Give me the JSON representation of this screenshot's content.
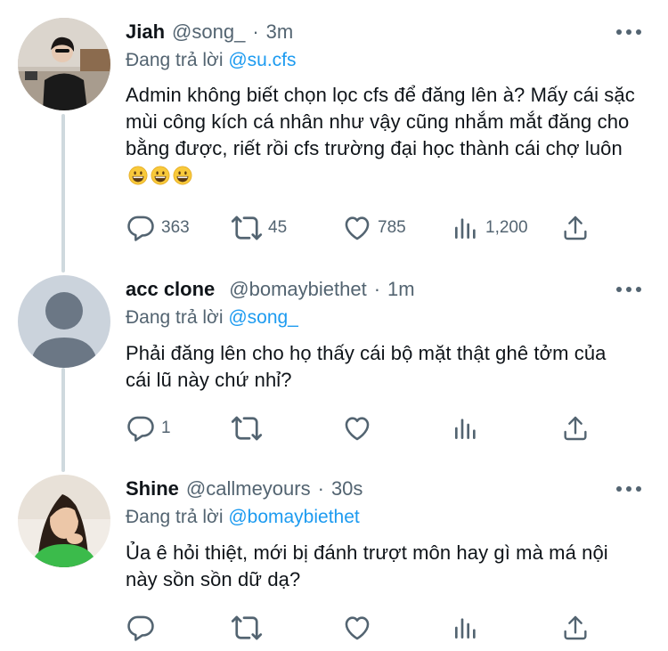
{
  "tweets": [
    {
      "name": "Jiah",
      "handle": "@song_",
      "dot": "·",
      "time": "3m",
      "replying_prefix": "Đang trả lời",
      "replying_to": "@su.cfs",
      "text": "Admin không biết chọn lọc cfs để đăng lên à? Mấy cái sặc mùi công kích cá nhân như vậy cũng nhắm mắt đăng cho bằng được, riết rồi cfs trường đại học thành cái chợ luôn",
      "emojis": [
        "grinning-face-emoji",
        "grinning-face-emoji",
        "grinning-face-emoji"
      ],
      "replies": "363",
      "retweets": "45",
      "likes": "785",
      "views": "1,200"
    },
    {
      "name": "acc clone",
      "handle": "@bomaybiethet",
      "dot": "·",
      "time": "1m",
      "replying_prefix": "Đang trả lời",
      "replying_to": "@song_",
      "text": "Phải đăng lên cho họ thấy cái bộ mặt thật ghê tởm của cái lũ này chứ nhỉ?",
      "replies": "1",
      "retweets": "",
      "likes": "",
      "views": ""
    },
    {
      "name": "Shine",
      "handle": "@callmeyours",
      "dot": "·",
      "time": "30s",
      "replying_prefix": "Đang trả lời",
      "replying_to": "@bomaybiethet",
      "text": "Ủa ê hỏi thiệt, mới bị đánh trượt môn hay gì mà má nội này sồn sồn dữ dạ?",
      "replies": "",
      "retweets": "",
      "likes": "",
      "views": ""
    }
  ],
  "colors": {
    "text": "#0f1419",
    "muted": "#536471",
    "link": "#1d9bf0",
    "thread_line": "#cfd9de"
  },
  "icons": [
    "reply-icon",
    "retweet-icon",
    "like-icon",
    "views-icon",
    "share-icon",
    "more-icon"
  ]
}
